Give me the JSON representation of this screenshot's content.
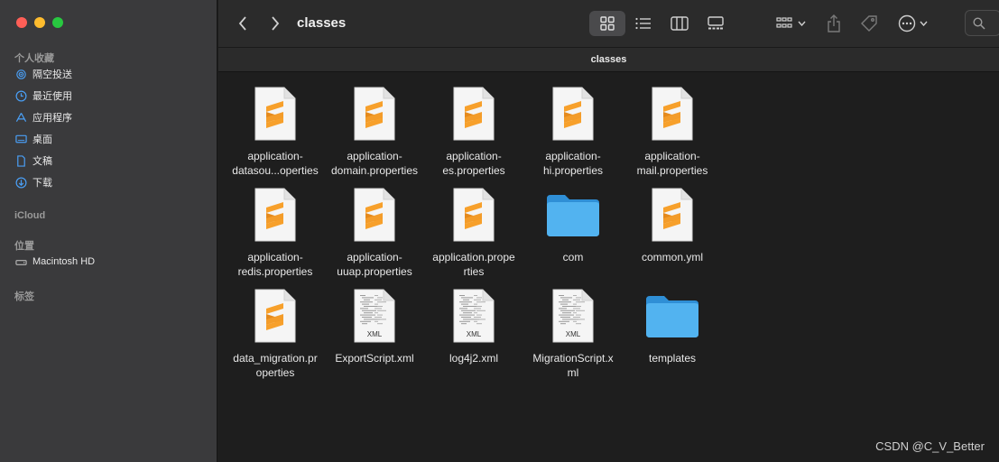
{
  "window": {
    "title": "classes",
    "path": "classes"
  },
  "sidebar": {
    "favorites_header": "个人收藏",
    "favorites": [
      {
        "label": "隔空投送",
        "icon": "airdrop-icon"
      },
      {
        "label": "最近使用",
        "icon": "clock-icon"
      },
      {
        "label": "应用程序",
        "icon": "apps-icon"
      },
      {
        "label": "桌面",
        "icon": "desktop-icon"
      },
      {
        "label": "文稿",
        "icon": "document-icon"
      },
      {
        "label": "下载",
        "icon": "download-icon"
      }
    ],
    "icloud_header": "iCloud",
    "locations_header": "位置",
    "locations": [
      {
        "label": "Macintosh HD",
        "icon": "disk-icon"
      }
    ],
    "tags_header": "标签"
  },
  "files": [
    {
      "name": "application-\ndatasou...operties",
      "kind": "sublime"
    },
    {
      "name": "application-\ndomain.properties",
      "kind": "sublime"
    },
    {
      "name": "application-\nes.properties",
      "kind": "sublime"
    },
    {
      "name": "application-\nhi.properties",
      "kind": "sublime"
    },
    {
      "name": "application-\nmail.properties",
      "kind": "sublime"
    },
    {
      "name": "application-\nredis.properties",
      "kind": "sublime"
    },
    {
      "name": "application-\nuuap.properties",
      "kind": "sublime"
    },
    {
      "name": "application.prope\nrties",
      "kind": "sublime"
    },
    {
      "name": "com",
      "kind": "folder"
    },
    {
      "name": "common.yml",
      "kind": "sublime"
    },
    {
      "name": "data_migration.pr\noperties",
      "kind": "sublime"
    },
    {
      "name": "ExportScript.xml",
      "kind": "xml"
    },
    {
      "name": "log4j2.xml",
      "kind": "xml"
    },
    {
      "name": "MigrationScript.x\nml",
      "kind": "xml"
    },
    {
      "name": "templates",
      "kind": "folder"
    }
  ],
  "xml_badge": "XML",
  "watermark": "CSDN @C_V_Better",
  "colors": {
    "folder": "#3fa4e6",
    "sublime": "#f39c2a",
    "sidebar_icon": "#4a9ff5"
  }
}
